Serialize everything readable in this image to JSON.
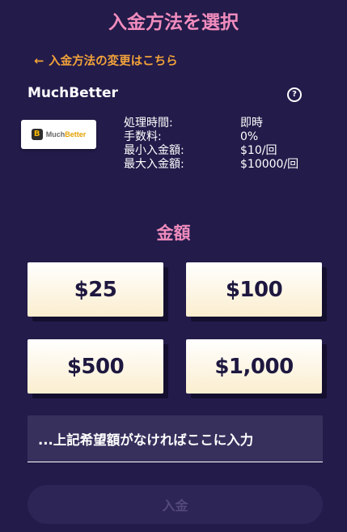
{
  "header": {
    "title": "入金方法を選択",
    "back_link": "入金方法の変更はこちら"
  },
  "method": {
    "name": "MuchBetter",
    "logo_text_prefix": "Much",
    "logo_text_suffix": "Better",
    "details": [
      {
        "label": "処理時間:",
        "value": "即時"
      },
      {
        "label": "手数料:",
        "value": "0%"
      },
      {
        "label": "最小入金額:",
        "value": "$10/回"
      },
      {
        "label": "最大入金額:",
        "value": "$10000/回"
      }
    ]
  },
  "amount": {
    "heading": "金額",
    "options": [
      "$25",
      "$100",
      "$500",
      "$1,000"
    ],
    "custom_placeholder": "...上記希望額がなければここに入力"
  },
  "submit": {
    "label": "入金",
    "enabled": false
  },
  "colors": {
    "background": "#231b4a",
    "accent_pink": "#f08cbd",
    "accent_orange": "#f2a33a"
  },
  "icons": {
    "back": "arrow-left-icon",
    "help": "question-circle-icon"
  }
}
